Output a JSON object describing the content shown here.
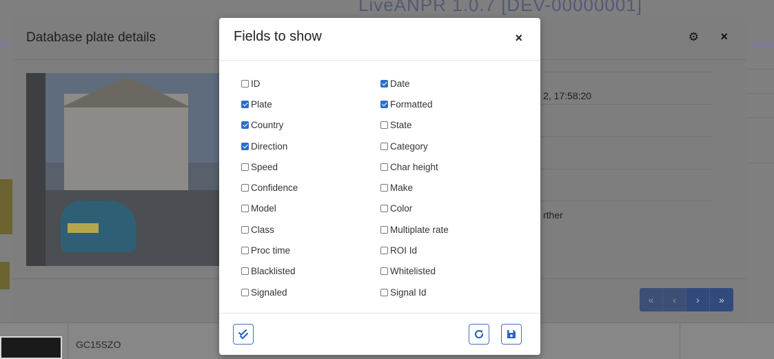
{
  "background": {
    "header_title": "LiveANPR 1.0.7 [DEV-00000001]",
    "table_row_plate": "GC15SZO"
  },
  "back_modal": {
    "title": "Database plate details",
    "gear_icon": "gear-icon",
    "close_label": "×",
    "date_value": "2, 17:58:20",
    "partial_text": "rther",
    "pager": [
      "«",
      "‹",
      "›",
      "»"
    ]
  },
  "dialog": {
    "title": "Fields to show",
    "close_label": "×",
    "left_fields": [
      {
        "label": "ID",
        "checked": false
      },
      {
        "label": "Plate",
        "checked": true
      },
      {
        "label": "Country",
        "checked": true
      },
      {
        "label": "Direction",
        "checked": true
      },
      {
        "label": "Speed",
        "checked": false
      },
      {
        "label": "Confidence",
        "checked": false
      },
      {
        "label": "Model",
        "checked": false
      },
      {
        "label": "Class",
        "checked": false
      },
      {
        "label": "Proc time",
        "checked": false
      },
      {
        "label": "Blacklisted",
        "checked": false
      },
      {
        "label": "Signaled",
        "checked": false
      }
    ],
    "right_fields": [
      {
        "label": "Date",
        "checked": true
      },
      {
        "label": "Formatted",
        "checked": true
      },
      {
        "label": "State",
        "checked": false
      },
      {
        "label": "Category",
        "checked": false
      },
      {
        "label": "Char height",
        "checked": false
      },
      {
        "label": "Make",
        "checked": false
      },
      {
        "label": "Color",
        "checked": false
      },
      {
        "label": "Multiplate rate",
        "checked": false
      },
      {
        "label": "ROI Id",
        "checked": false
      },
      {
        "label": "Whitelisted",
        "checked": false
      },
      {
        "label": "Signal Id",
        "checked": false
      }
    ],
    "footer": {
      "select_all_icon": "double-check-icon",
      "reset_icon": "refresh-icon",
      "save_icon": "save-icon"
    }
  },
  "colors": {
    "accent": "#2f6ec9",
    "overlay": "#7f7f7f",
    "pager": "#314a7c"
  }
}
